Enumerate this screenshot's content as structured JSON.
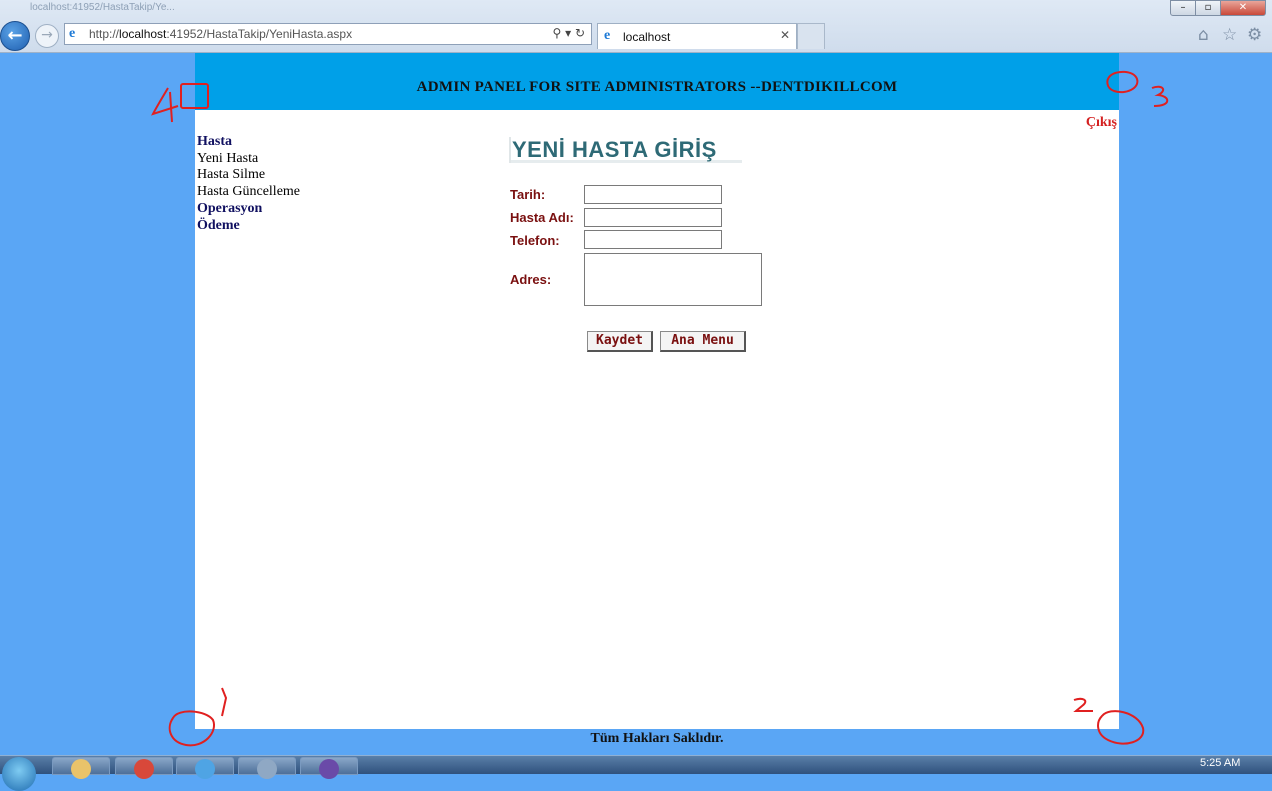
{
  "browser": {
    "titlebar_caption": "localhost:41952/HastaTakip/Ye...",
    "url_prefix": "http://",
    "url_host": "localhost",
    "url_rest": ":41952/HastaTakip/YeniHasta.aspx",
    "tab_title": "localhost"
  },
  "header": {
    "title": "ADMIN PANEL FOR SITE ADMINISTRATORS --DENTDIKILLCOM"
  },
  "logout_link": "Çıkış",
  "sidenav": {
    "items": [
      {
        "label": "Hasta",
        "kind": "heading"
      },
      {
        "label": "Yeni Hasta",
        "kind": "link"
      },
      {
        "label": "Hasta Silme",
        "kind": "link"
      },
      {
        "label": "Hasta Güncelleme",
        "kind": "link"
      },
      {
        "label": "Operasyon",
        "kind": "heading"
      },
      {
        "label": "Ödeme",
        "kind": "heading"
      }
    ]
  },
  "form": {
    "title": "YENİ HASTA GİRİŞ",
    "fields": {
      "date_label": "Tarih:",
      "name_label": "Hasta Adı:",
      "phone_label": "Telefon:",
      "address_label": "Adres:"
    },
    "values": {
      "date": "",
      "name": "",
      "phone": "",
      "address": ""
    },
    "save_label": "Kaydet",
    "main_menu_label": "Ana Menu"
  },
  "footer": {
    "text": "Tüm Hakları Saklıdır."
  },
  "annotations": {
    "color": "#e02020",
    "labels": [
      "4",
      "3",
      "1",
      "2"
    ]
  },
  "taskbar": {
    "time": "5:25 AM"
  },
  "colors": {
    "page_background": "#5aa6f5",
    "header_background": "#00a0e8",
    "label_color": "#7a1010",
    "title_color": "#2e6a76",
    "logout_color": "#d42020"
  }
}
